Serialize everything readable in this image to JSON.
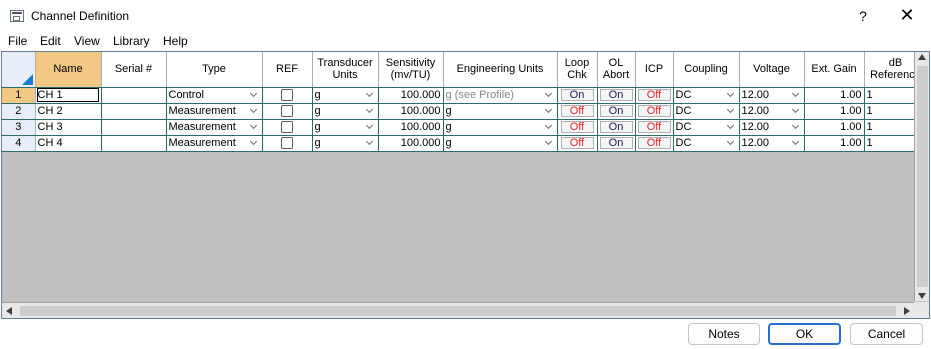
{
  "window": {
    "title": "Channel Definition",
    "help_label": "?",
    "close_label": "✕"
  },
  "menu": [
    "File",
    "Edit",
    "View",
    "Library",
    "Help"
  ],
  "columns": [
    "Name",
    "Serial #",
    "Type",
    "REF",
    "Transducer Units",
    "Sensitivity (mv/TU)",
    "Engineering Units",
    "Loop Chk",
    "OL Abort",
    "ICP",
    "Coupling",
    "Voltage",
    "Ext. Gain",
    "dB Reference"
  ],
  "rows": [
    {
      "num": "1",
      "name": "CH 1",
      "serial": "",
      "type": "Control",
      "ref": false,
      "units": "g",
      "sensitivity": "100.000",
      "eng_units": "g (see Profile)",
      "loop_chk": "On",
      "ol_abort": "On",
      "icp": "Off",
      "coupling": "DC",
      "voltage": "12.00",
      "ext_gain": "1.00",
      "db_ref": "1"
    },
    {
      "num": "2",
      "name": "CH 2",
      "serial": "",
      "type": "Measurement",
      "ref": false,
      "units": "g",
      "sensitivity": "100.000",
      "eng_units": "g",
      "loop_chk": "Off",
      "ol_abort": "On",
      "icp": "Off",
      "coupling": "DC",
      "voltage": "12.00",
      "ext_gain": "1.00",
      "db_ref": "1"
    },
    {
      "num": "3",
      "name": "CH 3",
      "serial": "",
      "type": "Measurement",
      "ref": false,
      "units": "g",
      "sensitivity": "100.000",
      "eng_units": "g",
      "loop_chk": "Off",
      "ol_abort": "On",
      "icp": "Off",
      "coupling": "DC",
      "voltage": "12.00",
      "ext_gain": "1.00",
      "db_ref": "1"
    },
    {
      "num": "4",
      "name": "CH 4",
      "serial": "",
      "type": "Measurement",
      "ref": false,
      "units": "g",
      "sensitivity": "100.000",
      "eng_units": "g",
      "loop_chk": "Off",
      "ol_abort": "On",
      "icp": "Off",
      "coupling": "DC",
      "voltage": "12.00",
      "ext_gain": "1.00",
      "db_ref": "1"
    }
  ],
  "buttons": {
    "notes": "Notes",
    "ok": "OK",
    "cancel": "Cancel"
  },
  "colors": {
    "selected_header": "#f2c886",
    "grid_line": "#2f6b6b",
    "toggle_off": "#e0262b",
    "toggle_on": "#1a1a60",
    "primary_border": "#2b6ecb",
    "empty_area": "#c0c0c0"
  }
}
